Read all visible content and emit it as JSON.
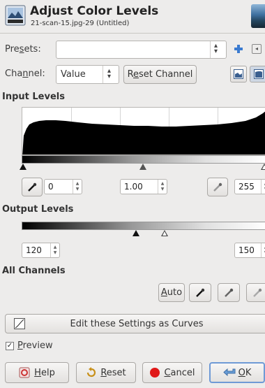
{
  "header": {
    "title": "Adjust Color Levels",
    "subtitle": "21-scan-15.jpg-29 (Untitled)",
    "icon": "levels-icon",
    "thumbnail": "image-thumbnail"
  },
  "presets": {
    "label": "Presets:",
    "value": "",
    "add_icon": "plus-icon",
    "menu_icon": "menu-arrow-icon"
  },
  "channel": {
    "label": "Channel:",
    "value": "Value",
    "reset_label": "Reset Channel",
    "linear_icon": "linear-histogram-icon",
    "log_icon": "log-histogram-icon"
  },
  "input_levels": {
    "heading": "Input Levels",
    "black_point": "0",
    "gamma": "1.00",
    "white_point": "255"
  },
  "output_levels": {
    "heading": "Output Levels",
    "low": "120",
    "high": "150"
  },
  "all_channels": {
    "heading": "All Channels",
    "auto_label": "Auto"
  },
  "curves_button": {
    "label": "Edit these Settings as Curves"
  },
  "preview": {
    "label": "Preview",
    "checked": true
  },
  "footer": {
    "help": "Help",
    "reset": "Reset",
    "cancel": "Cancel",
    "ok": "OK"
  },
  "colors": {
    "background": "#edeceb",
    "plus_icon": "#3b7bd0",
    "cancel_icon": "#e01818",
    "histogram": "#000000"
  }
}
